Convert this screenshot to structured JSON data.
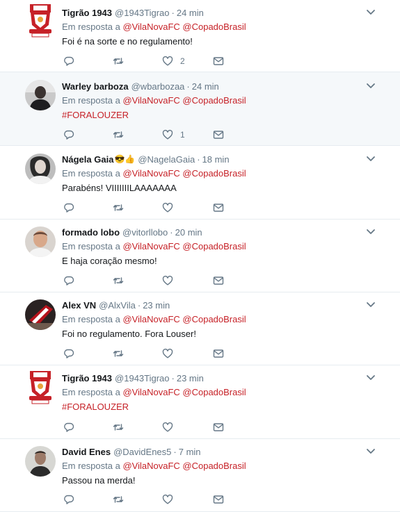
{
  "reply_prefix": "Em resposta a",
  "mention_1": "@VilaNovaFC",
  "mention_2": "@CopadoBrasil",
  "separator": "·",
  "tweets": [
    {
      "name": "Tigrão 1943",
      "handle": "@1943Tigrao",
      "time": "24 min",
      "text": "Foi é na sorte e no regulamento!",
      "likes": "2",
      "avatar": "club-crest"
    },
    {
      "name": "Warley barboza",
      "handle": "@wbarbozaa",
      "time": "24 min",
      "text": "#FORALOUZER",
      "likes": "1",
      "avatar": "user-photo"
    },
    {
      "name": "Nágela Gaia",
      "emoji": "😎👍",
      "handle": "@NagelaGaia",
      "time": "18 min",
      "text": "Parabéns! VIIIIIIILAAAAAAA",
      "likes": "",
      "avatar": "user-photo"
    },
    {
      "name": "formado lobo",
      "handle": "@vitorllobo",
      "time": "20 min",
      "text": "E haja coração mesmo!",
      "likes": "",
      "avatar": "user-photo"
    },
    {
      "name": "Alex VN",
      "handle": "@AlxVila",
      "time": "23 min",
      "text": "Foi no regulamento. Fora Louser!",
      "likes": "",
      "avatar": "user-photo"
    },
    {
      "name": "Tigrão 1943",
      "handle": "@1943Tigrao",
      "time": "23 min",
      "text": "#FORALOUZER",
      "likes": "",
      "avatar": "club-crest"
    },
    {
      "name": "David Enes",
      "handle": "@DavidEnes5",
      "time": "7 min",
      "text": "Passou na merda!",
      "likes": "",
      "avatar": "user-photo"
    }
  ],
  "colors": {
    "mention": "#c62127",
    "muted": "#657786",
    "highlight_bg": "#f5f8fa",
    "divider": "#e6ecf0"
  },
  "icons": [
    "reply-icon",
    "retweet-icon",
    "like-icon",
    "direct-message-icon",
    "chevron-down-icon"
  ]
}
